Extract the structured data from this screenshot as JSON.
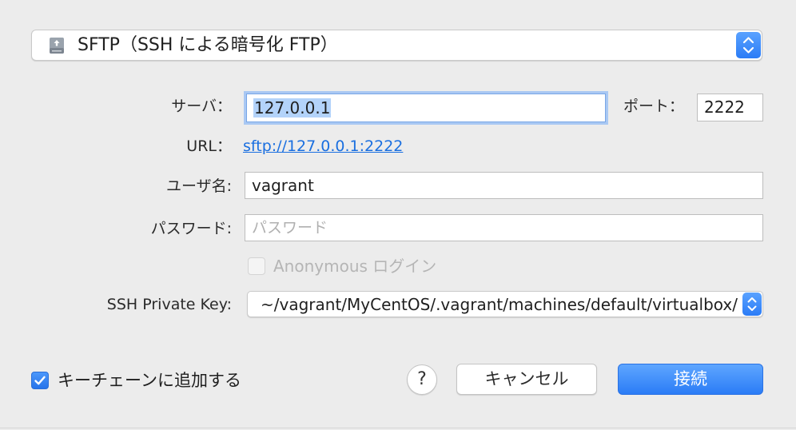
{
  "protocol": {
    "selected": "SFTP（SSH による暗号化 FTP）",
    "icon": "network-drive-icon"
  },
  "server": {
    "label": "サーバ：",
    "value": "127.0.0.1"
  },
  "port": {
    "label": "ポート：",
    "value": "2222"
  },
  "url": {
    "label": "URL：",
    "value": "sftp://127.0.0.1:2222"
  },
  "username": {
    "label": "ユーザ名:",
    "value": "vagrant"
  },
  "password": {
    "label": "パスワード:",
    "placeholder": "パスワード",
    "value": ""
  },
  "anonymous": {
    "label": "Anonymous ログイン",
    "checked": false,
    "enabled": false
  },
  "ssh_key": {
    "label": "SSH Private Key:",
    "value": "~/vagrant/MyCentOS/.vagrant/machines/default/virtualbox/private_key"
  },
  "keychain": {
    "label": "キーチェーンに追加する",
    "checked": true
  },
  "buttons": {
    "help": "?",
    "cancel": "キャンセル",
    "connect": "接続"
  },
  "colors": {
    "accent": "#2b7cf6",
    "link": "#1a6fe0",
    "background": "#ececec"
  }
}
